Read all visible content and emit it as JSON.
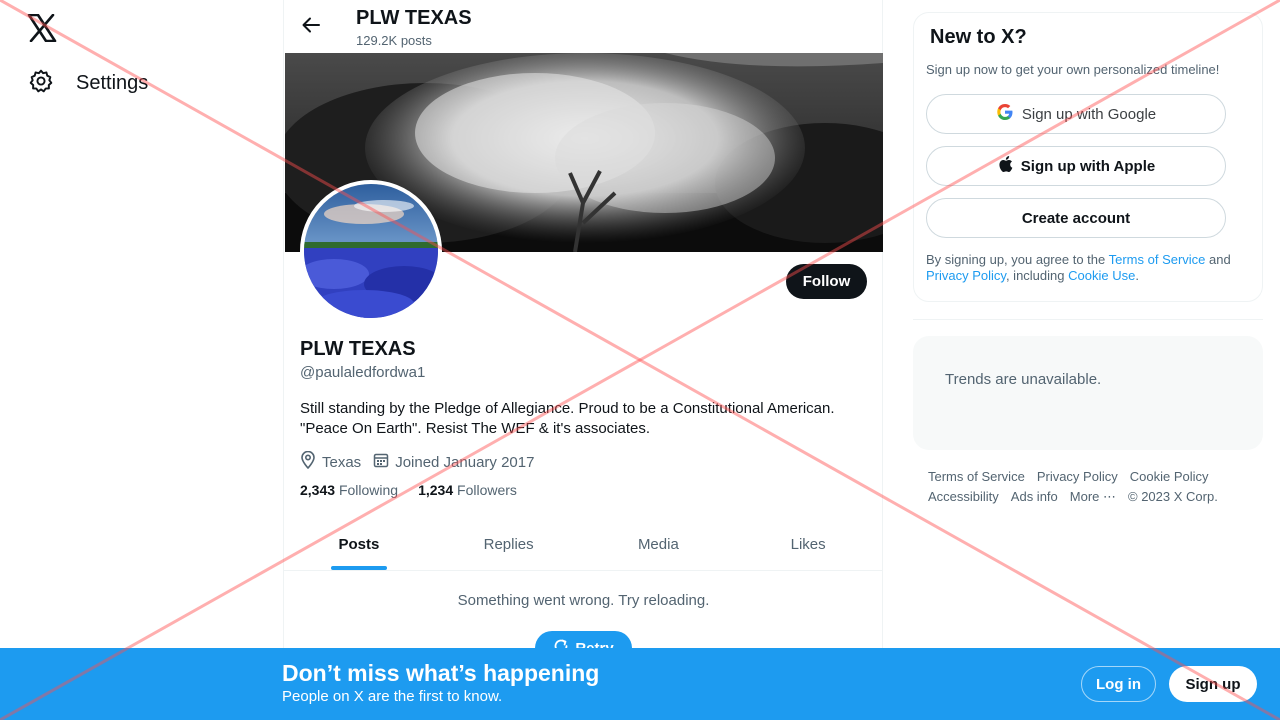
{
  "nav": {
    "settings_label": "Settings"
  },
  "header": {
    "title": "PLW TEXAS",
    "posts_count": "129.2K posts"
  },
  "profile": {
    "name": "PLW TEXAS",
    "handle": "@paulaledfordwa1",
    "bio_line1": "Still standing by the Pledge of Allegiance. Proud to be a Constitutional American.",
    "bio_line2": "\"Peace On Earth\". Resist The WEF & it's associates.",
    "location": "Texas",
    "joined": "Joined January 2017",
    "following_count": "2,343",
    "following_label": "Following",
    "followers_count": "1,234",
    "followers_label": "Followers",
    "follow_label": "Follow"
  },
  "tabs": [
    {
      "label": "Posts",
      "active": true
    },
    {
      "label": "Replies",
      "active": false
    },
    {
      "label": "Media",
      "active": false
    },
    {
      "label": "Likes",
      "active": false
    }
  ],
  "feed": {
    "error_text": "Something went wrong. Try reloading.",
    "retry_label": "Retry"
  },
  "signup": {
    "title": "New to X?",
    "subtitle": "Sign up now to get your own personalized timeline!",
    "google_label": "Sign up with Google",
    "apple_label": "Sign up with Apple",
    "create_label": "Create account",
    "terms_prefix": "By signing up, you agree to the ",
    "terms_link": "Terms of Service",
    "terms_and": " and ",
    "privacy_link": "Privacy Policy",
    "terms_including": ", including ",
    "cookie_link": "Cookie Use",
    "terms_end": "."
  },
  "trends": {
    "text": "Trends are unavailable."
  },
  "footer": {
    "row1": [
      "Terms of Service",
      "Privacy Policy",
      "Cookie Policy"
    ],
    "row2": [
      "Accessibility",
      "Ads info",
      "More ⋯",
      "© 2023 X Corp."
    ]
  },
  "bottom_bar": {
    "title": "Don’t miss what’s happening",
    "subtitle": "People on X are the first to know.",
    "login_label": "Log in",
    "signup_label": "Sign up"
  },
  "colors": {
    "accent": "#1d9bf0",
    "text": "#0f1419",
    "secondary": "#536471",
    "overlay_x": "#ff4d4d"
  }
}
